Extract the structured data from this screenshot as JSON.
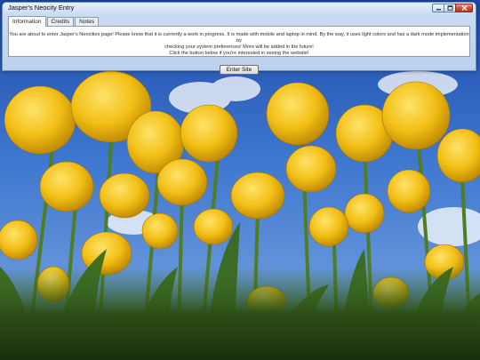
{
  "window": {
    "title": "Jasper's Neocity Entry"
  },
  "tabs": [
    {
      "label": "Information",
      "active": true
    },
    {
      "label": "Credits",
      "active": false
    },
    {
      "label": "Notes",
      "active": false
    }
  ],
  "panel": {
    "lines": [
      "You are about to enter Jasper's Neocities page! Please know that it is currently a work in progress. It is made with mobile and laptop in mind. By the way, it uses light colors and has a dark mode implementation by",
      "checking your system preferences! More will be added in the future!",
      "Click the button below if you're interested in seeing the website!"
    ]
  },
  "enter_button": {
    "label": "Enter Site"
  },
  "caption_buttons": [
    "minimize-icon",
    "maximize-icon",
    "close-icon"
  ],
  "colors": {
    "sky": "#2a5bb8",
    "tulip": "#f2c21b",
    "leaf": "#2f5b1e",
    "close_red": "#c9503a"
  }
}
